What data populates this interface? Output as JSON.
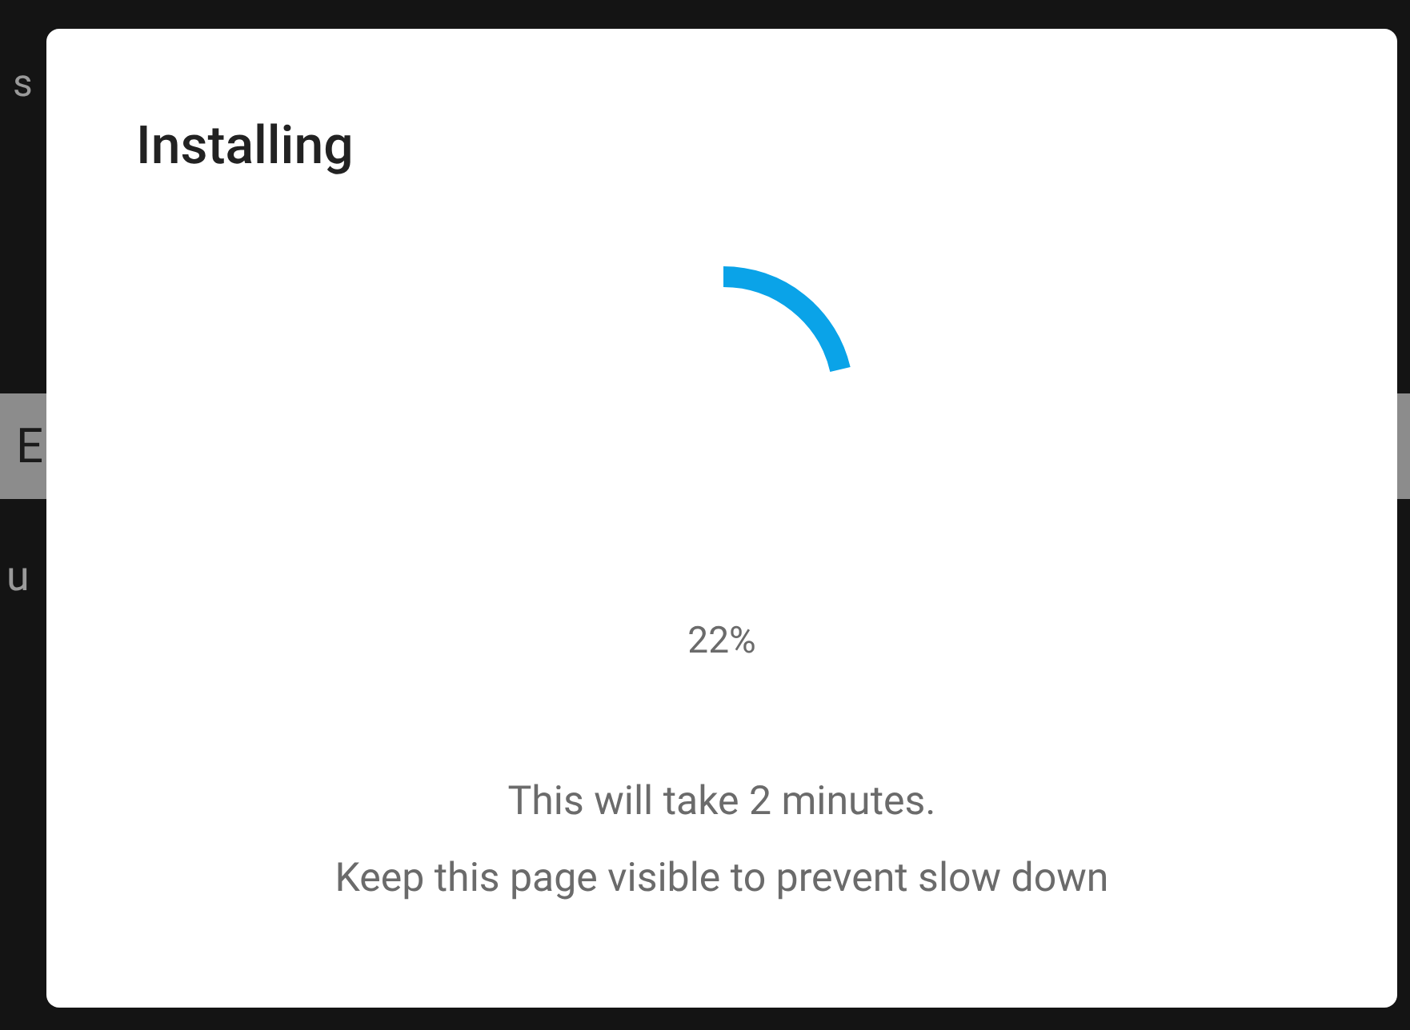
{
  "background": {
    "line_1": "s",
    "bar_text": "E",
    "row_left": "u"
  },
  "dialog": {
    "title": "Installing",
    "percent": "22%",
    "messages": [
      "This will take 2 minutes.",
      "Keep this page visible to prevent slow down"
    ]
  }
}
